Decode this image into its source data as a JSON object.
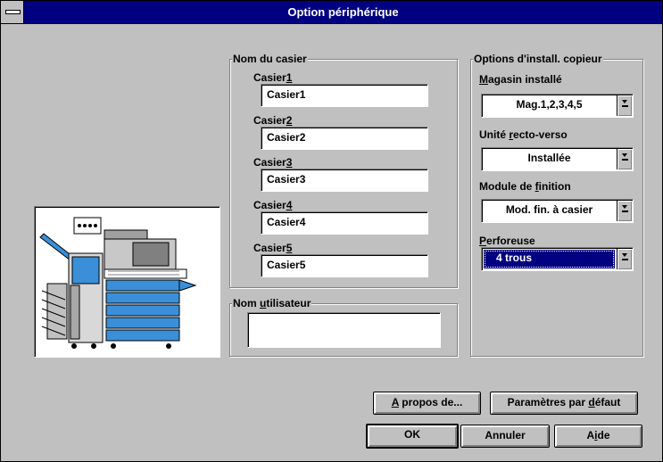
{
  "window": {
    "title": "Option périphérique"
  },
  "tray_names": {
    "legend": "Nom du casier",
    "items": [
      {
        "label_prefix": "Casier",
        "label_key": "1",
        "value": "Casier1"
      },
      {
        "label_prefix": "Casier",
        "label_key": "2",
        "value": "Casier2"
      },
      {
        "label_prefix": "Casier",
        "label_key": "3",
        "value": "Casier3"
      },
      {
        "label_prefix": "Casier",
        "label_key": "4",
        "value": "Casier4"
      },
      {
        "label_prefix": "Casier",
        "label_key": "5",
        "value": "Casier5"
      }
    ]
  },
  "user_name": {
    "legend_prefix": "Nom ",
    "legend_key": "u",
    "legend_suffix": "tilisateur",
    "value": ""
  },
  "copier_options": {
    "legend": "Options d'install. copieur",
    "magazine": {
      "label_key": "M",
      "label_rest": "agasin installé",
      "value": "Mag.1,2,3,4,5"
    },
    "duplex": {
      "label_prefix": "Unité ",
      "label_key": "r",
      "label_rest": "ecto-verso",
      "value": "Installée"
    },
    "finisher": {
      "label_prefix": "Module de ",
      "label_key": "f",
      "label_rest": "inition",
      "value": "Mod. fin. à casier"
    },
    "puncher": {
      "label_key": "P",
      "label_rest": "erforeuse",
      "value": "4 trous"
    }
  },
  "buttons": {
    "about": {
      "key": "A",
      "rest": " propos de..."
    },
    "defaults": {
      "prefix": "Paramètres par ",
      "key": "d",
      "rest": "éfaut"
    },
    "ok": "OK",
    "cancel": "Annuler",
    "help": {
      "prefix": "A",
      "key": "i",
      "rest": "de"
    }
  },
  "icons": {
    "system_menu": "system-menu-icon",
    "dropdown": "dropdown-arrow-icon"
  },
  "colors": {
    "titlebar": "#000080",
    "face": "#c0c0c0",
    "selection": "#000080",
    "printer_trays": "#3a8fd8"
  }
}
